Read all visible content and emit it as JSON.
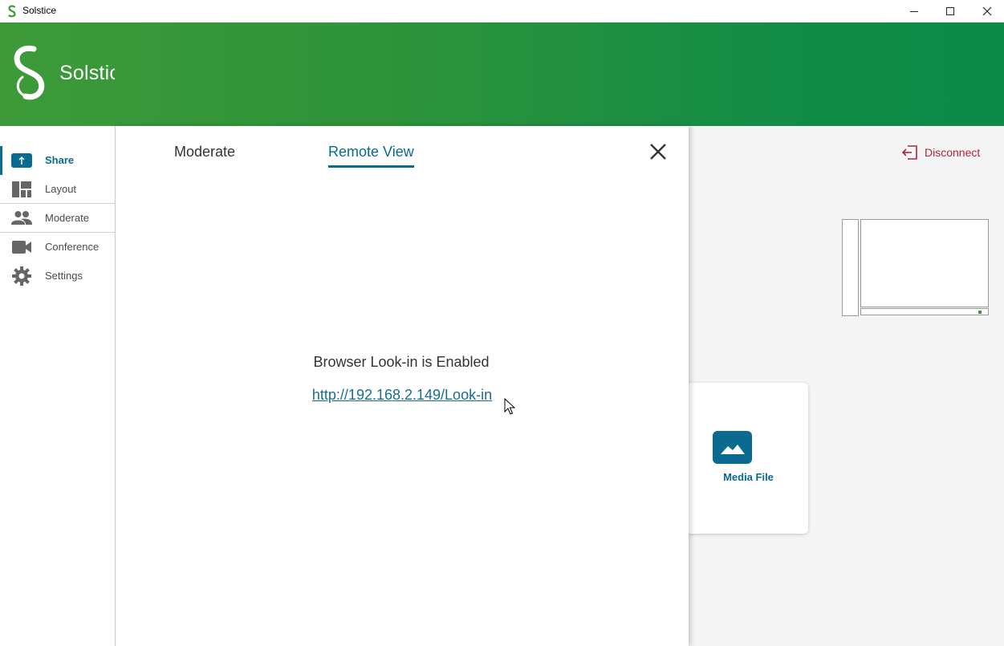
{
  "window": {
    "title": "Solstice"
  },
  "header": {
    "logo_text": "Solstic"
  },
  "sidebar": {
    "items": [
      {
        "label": "Share",
        "icon": "share-up-arrow-icon"
      },
      {
        "label": "Layout",
        "icon": "layout-icon"
      },
      {
        "label": "Moderate",
        "icon": "people-icon"
      },
      {
        "label": "Conference",
        "icon": "video-camera-icon"
      },
      {
        "label": "Settings",
        "icon": "gear-icon"
      }
    ],
    "active": "Share"
  },
  "dialog": {
    "tabs": [
      {
        "label": "Moderate"
      },
      {
        "label": "Remote View"
      }
    ],
    "active_tab": "Remote View",
    "lookin_title": "Browser Look-in is Enabled",
    "lookin_url": "http://192.168.2.149/Look-in"
  },
  "main": {
    "disconnect_label": "Disconnect",
    "media_card_label": "Media File"
  },
  "colors": {
    "accent": "#0b6a8f",
    "header_green_start": "#3e9a39",
    "header_green_end": "#0d8a48",
    "disconnect": "#b0243a"
  }
}
